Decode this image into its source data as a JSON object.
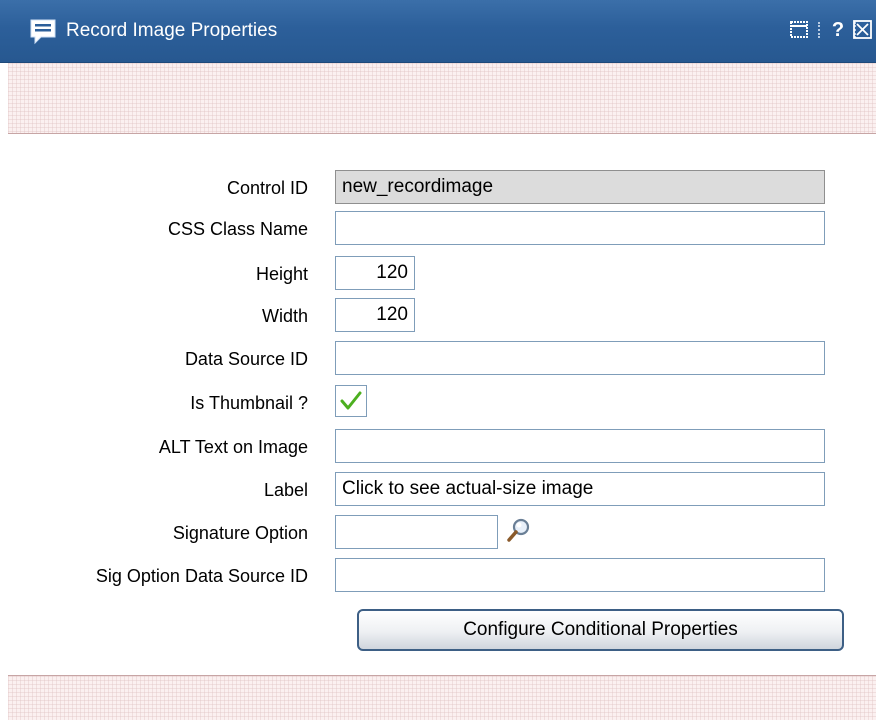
{
  "window": {
    "title": "Record Image Properties",
    "icons": [
      "note-icon",
      "restore-icon",
      "help-icon",
      "close-icon"
    ],
    "help_label": "?"
  },
  "form": {
    "control_id": {
      "label": "Control ID",
      "value": "new_recordimage"
    },
    "css_class_name": {
      "label": "CSS Class Name",
      "value": ""
    },
    "height": {
      "label": "Height",
      "value": "120"
    },
    "width": {
      "label": "Width",
      "value": "120"
    },
    "data_source_id": {
      "label": "Data Source ID",
      "value": ""
    },
    "is_thumbnail": {
      "label": "Is Thumbnail ?",
      "checked": true
    },
    "alt_text": {
      "label": "ALT Text on Image",
      "value": ""
    },
    "label": {
      "label": "Label",
      "value": "Click to see actual-size image"
    },
    "signature_option": {
      "label": "Signature Option",
      "value": "",
      "icon": "search-icon"
    },
    "sig_option_data_source_id": {
      "label": "Sig Option Data Source ID",
      "value": ""
    }
  },
  "buttons": {
    "configure_conditional": "Configure Conditional Properties"
  },
  "colors": {
    "title_bar": "#2c5f9a",
    "band": "#fbf0f0",
    "check": "#4caf1f"
  }
}
